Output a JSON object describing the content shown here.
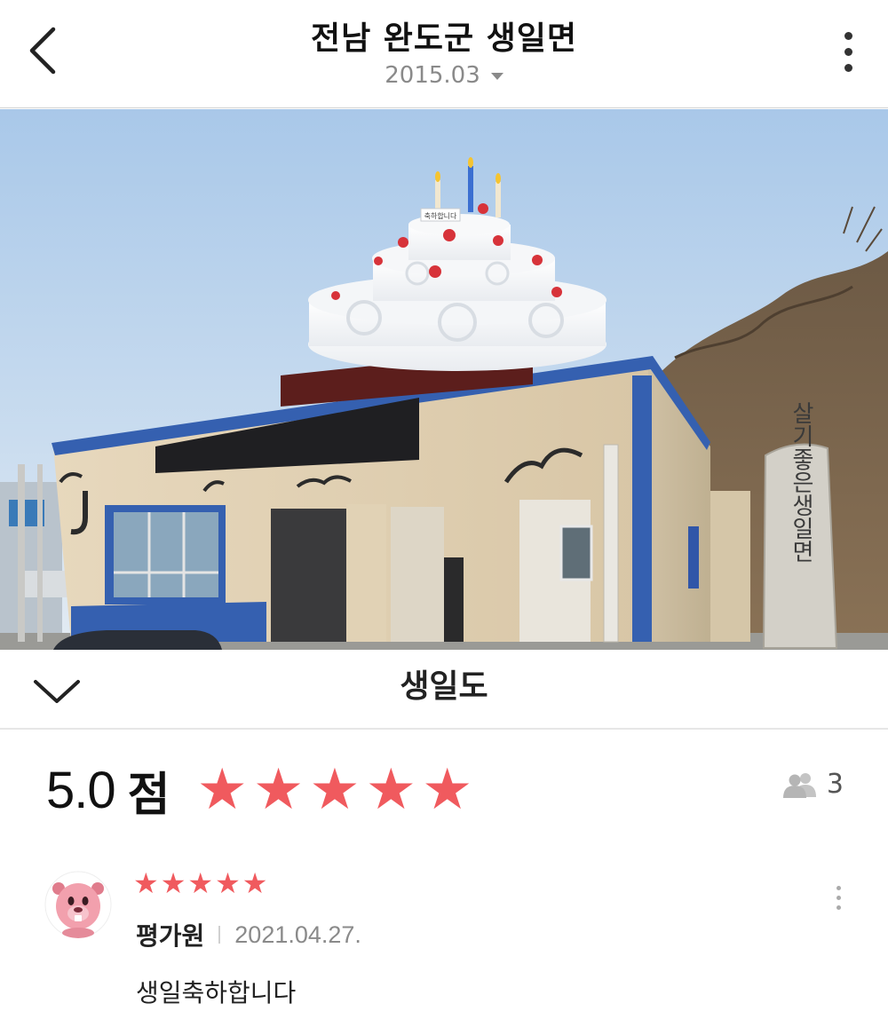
{
  "header": {
    "title": "전남 완도군 생일면",
    "date": "2015.03",
    "back_icon": "chevron-left-icon",
    "more_icon": "more-vertical-icon"
  },
  "photo": {
    "cake_sign": "축하합니다",
    "stone_sign": "살기좋은생일면"
  },
  "place": {
    "name": "생일도",
    "collapse_icon": "chevron-down-icon"
  },
  "rating": {
    "score": "5.0",
    "unit": "점",
    "stars": 5,
    "max_stars": 5,
    "reviewer_count": "3",
    "reviewer_icon": "people-icon",
    "star_color": "#f05a5e"
  },
  "reviews": [
    {
      "stars": 5,
      "author": "평가원",
      "date": "2021.04.27.",
      "text": "생일축하합니다",
      "avatar_icon": "beaver-avatar-icon"
    }
  ]
}
